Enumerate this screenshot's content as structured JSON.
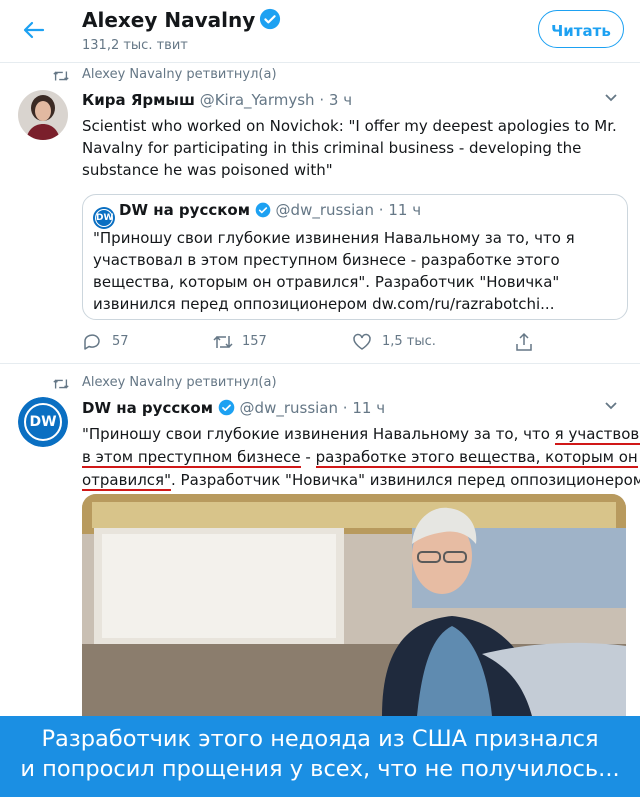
{
  "header": {
    "name": "Alexey Navalny",
    "tweet_count": "131,2 тыс. твит",
    "read_button": "Читать"
  },
  "tweet1": {
    "retweet_label": "Alexey Navalny ретвитнул(а)",
    "author_name": "Кира Ярмыш",
    "author_handle": "@Kira_Yarmysh",
    "sep": "·",
    "time": "3 ч",
    "text": "Scientist who worked on Novichok: \"I offer my deepest apologies to Mr. Navalny for participating in this criminal business - developing the substance he was poisoned with\"",
    "quote": {
      "author_name": "DW на русском",
      "author_handle": "@dw_russian",
      "time": "11 ч",
      "text": "\"Приношу свои глубокие извинения Навальному за то, что я участвовал в этом преступном бизнесе - разработке этого вещества, которым он отравился\". Разработчик \"Новичка\" извинился перед оппозиционером dw.com/ru/razrabotchi..."
    },
    "replies": "57",
    "retweets": "157",
    "likes": "1,5 тыс."
  },
  "tweet2": {
    "retweet_label": "Alexey Navalny ретвитнул(а)",
    "author_name": "DW на русском",
    "author_handle": "@dw_russian",
    "time": "11 ч",
    "line1_a": "\"Приношу свои глубокие извинения Навальному за то, что ",
    "line1_b": "я участвовал",
    "line2_a": "в этом преступном бизнесе",
    "line2_b": " - ",
    "line2_c": "разработке этого вещества, которым он",
    "line3_a": "отравился\"",
    "line3_b": ". Разработчик \"Новичка\" извинился перед оппозиционером"
  },
  "dw_logo_text": "DW",
  "banner": {
    "line1": "Разработчик этого недояда из США признался",
    "line2": "и попросил прощения у всех, что не получилось..."
  },
  "colors": {
    "twitter_blue": "#1da1f2",
    "dw_blue": "#0a6fc2",
    "underline_red": "#d01818",
    "banner_blue": "#1b8fe3"
  }
}
